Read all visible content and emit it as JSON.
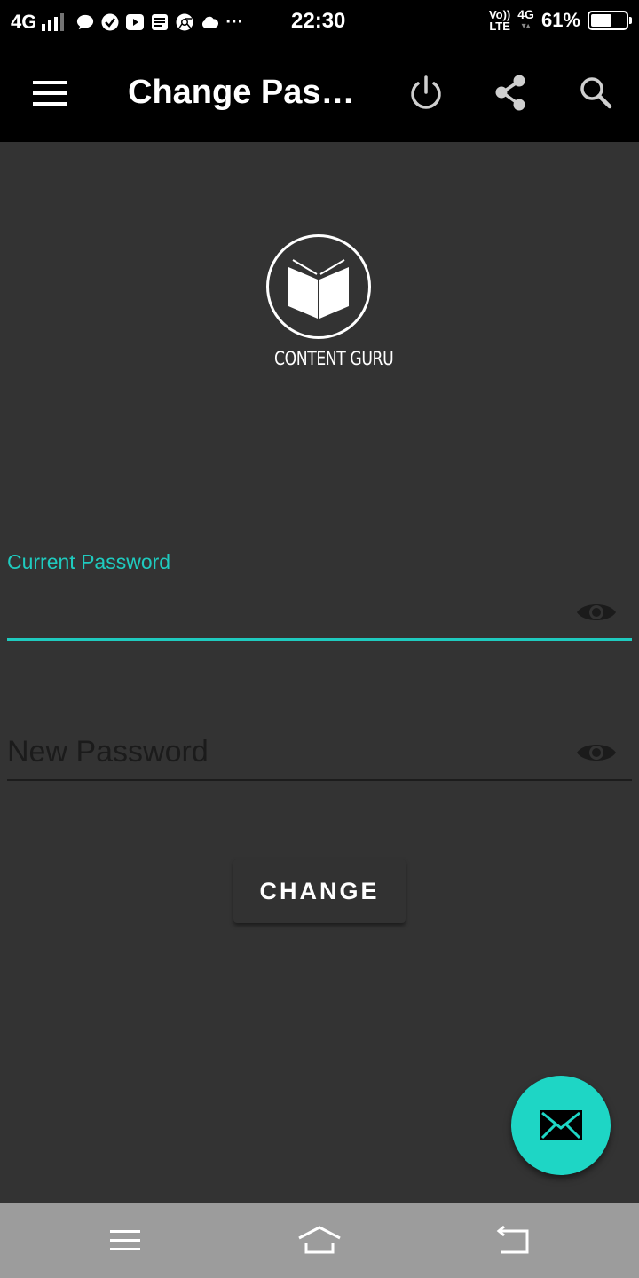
{
  "status_bar": {
    "network": "4G",
    "time": "22:30",
    "volte_top": "Vo))",
    "volte_bottom": "LTE",
    "data_type": "4G",
    "battery_percent": "61%",
    "battery_level": 0.61,
    "overflow": "···"
  },
  "app_bar": {
    "title": "Change Pas…",
    "icons": [
      "menu-icon",
      "power-icon",
      "share-icon",
      "search-icon"
    ]
  },
  "logo": {
    "text": "CONTENT GURU",
    "icon": "open-book-icon"
  },
  "form": {
    "current_password_label": "Current Password",
    "current_password_value": "",
    "new_password_placeholder": "New Password",
    "visibility_icon": "eye-icon",
    "submit_label": "CHANGE"
  },
  "fab": {
    "icon": "mail-icon"
  },
  "colors": {
    "accent": "#1fcbbf",
    "fab": "#1ed6c5",
    "background": "#333333",
    "app_bar": "#000000",
    "nav_bar": "#9c9c9c"
  },
  "nav_bar": {
    "icons": [
      "recent-apps-icon",
      "home-icon",
      "back-icon"
    ]
  }
}
